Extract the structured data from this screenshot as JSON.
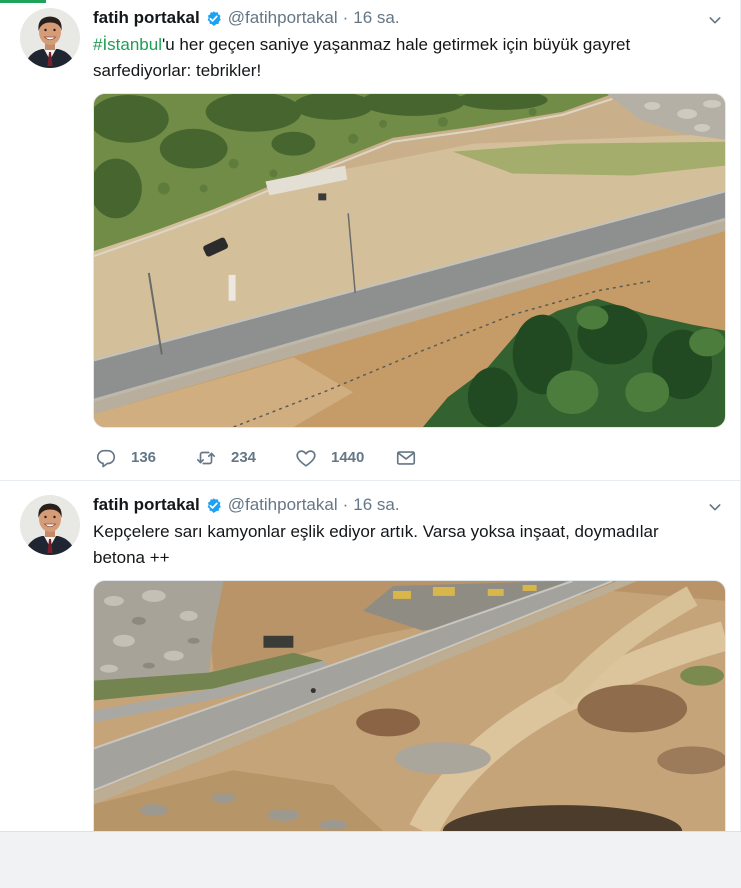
{
  "colors": {
    "text": "#14171a",
    "muted": "#657786",
    "hashtag": "#1f9d55",
    "verified": "#1da1f2",
    "divider": "#e6ecf0",
    "tab_indicator": "#1fa35a",
    "footer_background": "#f0f2f3"
  },
  "icons": {
    "verified": "verified-badge-icon",
    "more": "chevron-down-icon",
    "reply": "reply-icon",
    "retweet": "retweet-icon",
    "like": "heart-icon",
    "message": "envelope-icon"
  },
  "tweets": [
    {
      "author_name": "fatih portakal",
      "author_handle": "@fatihportakal",
      "verified": true,
      "separator": "·",
      "timestamp": "16 sa.",
      "hashtag": "#İstanbul",
      "text": "'u her geçen saniye yaşanmaz hale getirmek için büyük gayret sarfediyorlar: tebrikler!",
      "actions": {
        "reply_count": "136",
        "retweet_count": "234",
        "like_count": "1440"
      }
    },
    {
      "author_name": "fatih portakal",
      "author_handle": "@fatihportakal",
      "verified": true,
      "separator": "·",
      "timestamp": "16 sa.",
      "text": "Kepçelere sarı kamyonlar eşlik ediyor artık. Varsa yoksa inşaat, doymadılar betona ++"
    }
  ]
}
